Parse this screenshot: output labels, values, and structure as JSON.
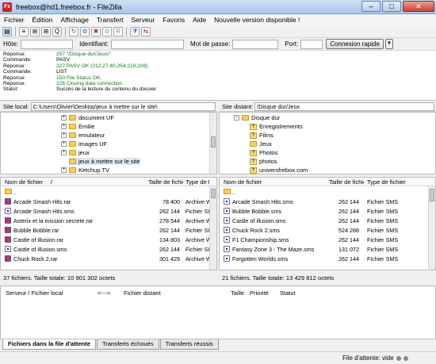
{
  "window": {
    "title": "freebox@hd1.freebox.fr - FileZilla",
    "controls": [
      "–",
      "□",
      "✕"
    ]
  },
  "menu": [
    "Fichier",
    "Édition",
    "Affichage",
    "Transfert",
    "Serveur",
    "Favoris",
    "Aide",
    "Nouvelle version disponible !"
  ],
  "toolbar": {
    "icons": [
      "site-manager-icon",
      "toggle-log-icon",
      "toggle-local-tree-icon",
      "toggle-remote-tree-icon",
      "toggle-queue-icon",
      "refresh-icon",
      "process-queue-icon",
      "cancel-icon",
      "disconnect-icon",
      "reconnect-icon",
      "filter-icon",
      "compare-icon"
    ]
  },
  "quickconnect": {
    "host_label": "Hôte:",
    "user_label": "Identifiant:",
    "pass_label": "Mot de passe:",
    "port_label": "Port:",
    "host_value": "",
    "user_value": "",
    "pass_value": "",
    "port_value": "",
    "button_label": "Connexion rapide",
    "dropdown_glyph": "▼"
  },
  "log": [
    {
      "type": "Réponse:",
      "text": "257 \"/Disque dur/Jeux/\"",
      "color": "green"
    },
    {
      "type": "Commande:",
      "text": "PASV",
      "color": "black"
    },
    {
      "type": "Réponse:",
      "text": "227 PASV OK (212,27,40,254,219,208)",
      "color": "green"
    },
    {
      "type": "Commande:",
      "text": "LIST",
      "color": "black"
    },
    {
      "type": "Réponse:",
      "text": "150 File Status OK.",
      "color": "green"
    },
    {
      "type": "Réponse:",
      "text": "226 Closing data connection.",
      "color": "green"
    },
    {
      "type": "Statut:",
      "text": "Succès de la lecture du contenu du dossier",
      "color": "black"
    }
  ],
  "local": {
    "label": "Site local:",
    "path": "C:\\Users\\Olivier\\Desktop\\jeux à mettre sur le site\\",
    "tree": [
      "document UF",
      "Emilie",
      "emulateur",
      "images UF",
      "jeux",
      "jeux à mettre sur le site",
      "Ketchup TV"
    ],
    "columns": [
      "Nom de fichier",
      "Taille de fichier",
      "Type de fi"
    ],
    "sort_glyph": "/",
    "parent": "..",
    "files": [
      {
        "name": "Arcade Smash Hits.rar",
        "size": "78 400",
        "type": "Archive W",
        "icon": "rar"
      },
      {
        "name": "Arcade Smash Hits.sms",
        "size": "262 144",
        "type": "Fichier SI",
        "icon": "sms"
      },
      {
        "name": "Asterix et la mission secrete.rar",
        "size": "278 544",
        "type": "Archive W",
        "icon": "rar"
      },
      {
        "name": "Bubble Bobble.rar",
        "size": "262 144",
        "type": "Fichier SI",
        "icon": "rar"
      },
      {
        "name": "Castle of illusion.rar",
        "size": "134 803",
        "type": "Archive W",
        "icon": "rar"
      },
      {
        "name": "Castle of illusion.sms",
        "size": "262 144",
        "type": "Fichier SI",
        "icon": "sms"
      },
      {
        "name": "Chuck Rock 2.rar",
        "size": "301 429",
        "type": "Archive W",
        "icon": "rar"
      }
    ],
    "summary": "37 fichiers. Taille totale: 10 901 302 octets"
  },
  "remote": {
    "label": "Site distant:",
    "path": "/Disque dur/Jeux",
    "tree_root": "Disque dur",
    "tree": [
      "Enregistrements",
      "Films",
      "Jeux",
      "Photos",
      "photos",
      "universfrebox.com"
    ],
    "columns": [
      "Nom de fichier",
      "Taille de fichier",
      "Type de fichier"
    ],
    "parent": "..",
    "files": [
      {
        "name": "Arcade Smash Hits.sms",
        "size": "262 144",
        "type": "Fichier SMS"
      },
      {
        "name": "Bubble Bobble.sms",
        "size": "262 144",
        "type": "Fichier SMS"
      },
      {
        "name": "Castle of illusion.sms",
        "size": "262 144",
        "type": "Fichier SMS"
      },
      {
        "name": "Chuck Rock 2.sms",
        "size": "524 288",
        "type": "Fichier SMS"
      },
      {
        "name": "F1 Championship.sms",
        "size": "262 144",
        "type": "Fichier SMS"
      },
      {
        "name": "Fantasy Zone 3 - The Maze.sms",
        "size": "131 072",
        "type": "Fichier SMS"
      },
      {
        "name": "Forgotten Worlds.sms",
        "size": "262 144",
        "type": "Fichier SMS"
      }
    ],
    "summary": "21 fichiers. Taille totale: 13 429 812 octets"
  },
  "queue": {
    "columns": [
      "Serveur / Fichier local",
      "<--->",
      "Fichier distant",
      "Taille",
      "Priorité",
      "Statut"
    ]
  },
  "tabs": [
    "Fichiers dans la file d'attente",
    "Transferts échoués",
    "Transferts réussis"
  ],
  "statusbar": {
    "queue": "File d'attente: vide"
  }
}
